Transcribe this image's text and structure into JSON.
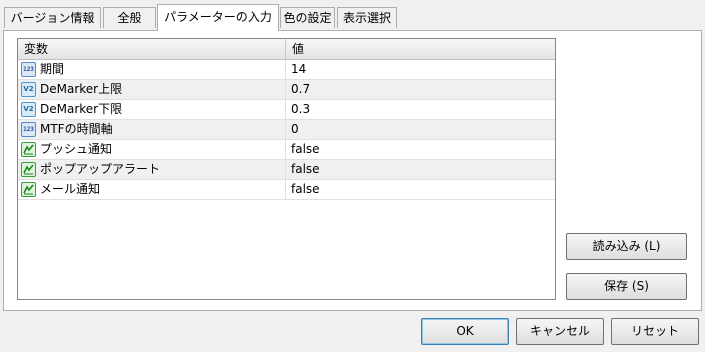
{
  "tabs": [
    {
      "label": "バージョン情報"
    },
    {
      "label": "全般"
    },
    {
      "label": "パラメーターの入力"
    },
    {
      "label": "色の設定"
    },
    {
      "label": "表示選択"
    }
  ],
  "active_tab": "パラメーターの入力",
  "grid": {
    "header": {
      "variable": "変数",
      "value": "値"
    },
    "rows": [
      {
        "name": "期間",
        "value": "14",
        "icon": "integer-icon"
      },
      {
        "name": "DeMarker上限",
        "value": "0.7",
        "icon": "double-icon"
      },
      {
        "name": "DeMarker下限",
        "value": "0.3",
        "icon": "double-icon"
      },
      {
        "name": "MTFの時間軸",
        "value": "0",
        "icon": "integer-icon"
      },
      {
        "name": "プッシュ通知",
        "value": "false",
        "icon": "bool-icon"
      },
      {
        "name": "ポップアップアラート",
        "value": "false",
        "icon": "bool-icon"
      },
      {
        "name": "メール通知",
        "value": "false",
        "icon": "bool-icon"
      }
    ]
  },
  "buttons": {
    "load": "読み込み (L)",
    "save": "保存 (S)",
    "ok": "OK",
    "cancel": "キャンセル",
    "reset": "リセット"
  }
}
